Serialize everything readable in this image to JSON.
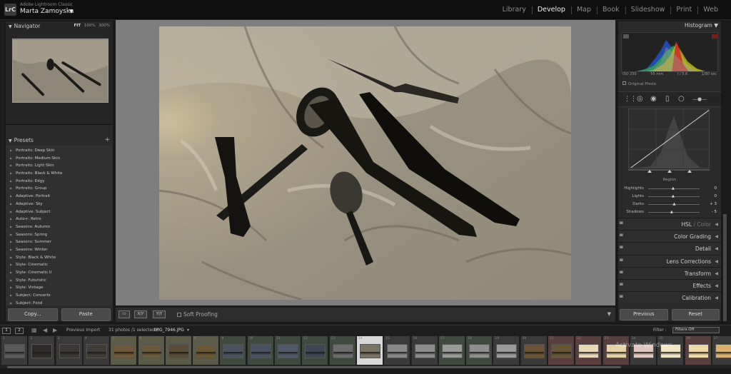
{
  "topbar": {
    "logo": "LrC",
    "app_name": "Adobe Lightroom Classic",
    "user_name": "Marta Zamoyska",
    "user_caret": "▼",
    "modules": [
      "Library",
      "Develop",
      "Map",
      "Book",
      "Slideshow",
      "Print",
      "Web"
    ],
    "active_module": "Develop"
  },
  "navigator": {
    "title": "Navigator",
    "zoom_fit": "FIT",
    "zoom_100": "100%",
    "zoom_300": "300%"
  },
  "presets": {
    "title": "Presets",
    "add_icon": "plus-icon",
    "items": [
      "Portraits: Deep Skin",
      "Portraits: Medium Skin",
      "Portraits: Light Skin",
      "Portraits: Black & White",
      "Portraits: Edgy",
      "Portraits: Group",
      "Adaptive: Portrait",
      "Adaptive: Sky",
      "Adaptive: Subject",
      "Auto+: Retro",
      "Seasons: Autumn",
      "Seasons: Spring",
      "Seasons: Summer",
      "Seasons: Winter",
      "Style: Black & White",
      "Style: Cinematic",
      "Style: Cinematic II",
      "Style: Futuristic",
      "Style: Vintage",
      "Subject: Concerts",
      "Subject: Food"
    ]
  },
  "left_buttons": {
    "copy": "Copy...",
    "paste": "Paste"
  },
  "toolbar": {
    "soft_proofing": "Soft Proofing",
    "view_a": "X|Y",
    "view_b": "Y|Y"
  },
  "histogram": {
    "title": "Histogram",
    "iso": "ISO 250",
    "focal": "55 mm",
    "aperture": "f / 5.6",
    "shutter": "1/80 sec",
    "original_photo": "Original Photo"
  },
  "tone_curve": {
    "region_label": "Region",
    "sliders": [
      {
        "label": "Highlights",
        "value": "0",
        "pos": 0.5
      },
      {
        "label": "Lights",
        "value": "0",
        "pos": 0.5
      },
      {
        "label": "Darks",
        "value": "+ 3",
        "pos": 0.52
      },
      {
        "label": "Shadows",
        "value": "- 5",
        "pos": 0.47
      }
    ]
  },
  "sections": [
    {
      "name": "HSL",
      "sep": " / ",
      "sub": "Color"
    },
    {
      "name": "Color Grading"
    },
    {
      "name": "Detail"
    },
    {
      "name": "Lens Corrections"
    },
    {
      "name": "Transform"
    },
    {
      "name": "Effects"
    },
    {
      "name": "Calibration"
    }
  ],
  "right_buttons": {
    "previous": "Previous",
    "reset": "Reset"
  },
  "filmstrip": {
    "view1": "1",
    "view2": "2",
    "source": "Previous Import",
    "count": "31 photos /1 selected /",
    "filename": "IMG_7946.JPG",
    "filename_caret": "▾",
    "filter_label": "Filter :",
    "filter_value": "Filters Off",
    "numbers": [
      "1",
      "2",
      "3",
      "4",
      "5",
      "6",
      "7",
      "8",
      "9",
      "10",
      "11",
      "12",
      "13",
      "14",
      "15",
      "16",
      "17",
      "18",
      "19",
      "20",
      "21",
      "22",
      "23",
      "24",
      "25",
      "26",
      "27"
    ],
    "selected_index": 13,
    "watermark": "Activate Windows"
  },
  "colors": {
    "accent": "#f2f2f2",
    "panel": "#2a2a2a",
    "canvas": "#7e7e7e"
  }
}
